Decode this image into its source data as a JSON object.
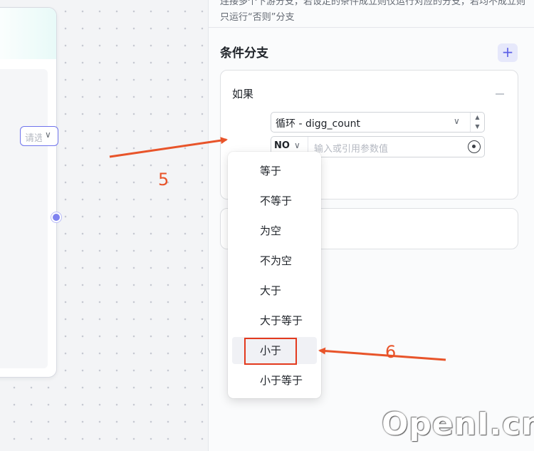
{
  "panel": {
    "description": "连接多个下游分支，若设定的条件成立则仅运行对应的分支，若均不成立则只运行“否则”分支",
    "section_title": "条件分支",
    "add_label": "+",
    "if_card": {
      "label": "如果",
      "operator_placeholder": "请选择",
      "variable_value": "循环 - digg_count",
      "value_type": "NO",
      "value_placeholder": "输入或引用参数值"
    }
  },
  "dropdown": {
    "options": [
      "等于",
      "不等于",
      "为空",
      "不为空",
      "大于",
      "大于等于",
      "小于",
      "小于等于"
    ],
    "highlighted_index": 6
  },
  "annotations": {
    "step_a": "5",
    "step_b": "6",
    "accent_color": "#e8542a",
    "box_color": "#e33a1e"
  },
  "watermark": "OpenI.cn",
  "colors": {
    "primary": "#5b5fe6",
    "port": "#7f83f0"
  }
}
